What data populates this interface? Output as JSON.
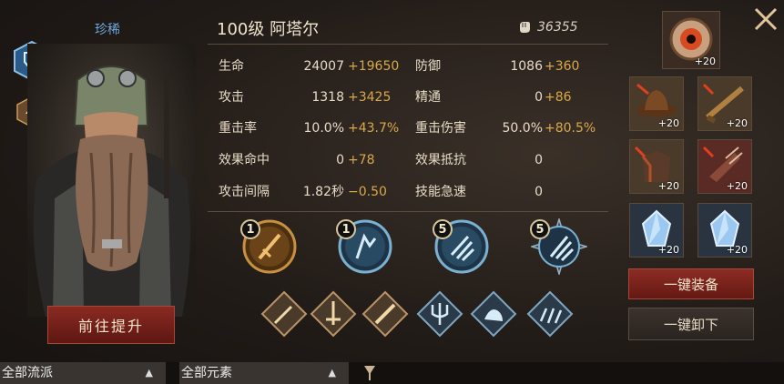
{
  "hero": {
    "rarity": "珍稀",
    "level_name": "100级  阿塔尔",
    "power": "36355",
    "goto_button": "前往提升"
  },
  "stats": [
    {
      "label": "生命",
      "value": "24007",
      "bonus": "+19650"
    },
    {
      "label": "防御",
      "value": "1086",
      "bonus": "+360"
    },
    {
      "label": "攻击",
      "value": "1318",
      "bonus": "+3425"
    },
    {
      "label": "精通",
      "value": "0",
      "bonus": "+86"
    },
    {
      "label": "重击率",
      "value": "10.0%",
      "bonus": "+43.7%"
    },
    {
      "label": "重击伤害",
      "value": "50.0%",
      "bonus": "+80.5%"
    },
    {
      "label": "效果命中",
      "value": "0",
      "bonus": "+78"
    },
    {
      "label": "效果抵抗",
      "value": "0",
      "bonus": ""
    },
    {
      "label": "攻击间隔",
      "value": "1.82秒",
      "bonus": "−0.50"
    },
    {
      "label": "技能急速",
      "value": "0",
      "bonus": ""
    }
  ],
  "skills": [
    {
      "level": "1",
      "icon": "sword-skill-icon"
    },
    {
      "level": "1",
      "icon": "strike-skill-icon"
    },
    {
      "level": "5",
      "icon": "claw-skill-icon"
    },
    {
      "level": "5",
      "icon": "trident-skill-icon"
    }
  ],
  "runes": [
    "dagger-rune-icon",
    "sword-rune-icon",
    "blade-rune-icon",
    "trident-rune-icon",
    "beast-rune-icon",
    "triple-rune-icon"
  ],
  "equipment": [
    {
      "name": "eye-orb-icon",
      "level": "+20"
    },
    {
      "name": "hat-icon",
      "level": "+20"
    },
    {
      "name": "gun-icon",
      "level": "+20"
    },
    {
      "name": "armor-icon",
      "level": "+20"
    },
    {
      "name": "gauntlet-icon",
      "level": "+20"
    },
    {
      "name": "crystal-icon",
      "level": "+20"
    },
    {
      "name": "crystal-icon",
      "level": "+20"
    }
  ],
  "buttons": {
    "equip_all": "一键装备",
    "unequip_all": "一键卸下"
  },
  "filters": {
    "school": "全部流派",
    "element": "全部元素"
  },
  "colors": {
    "bonus": "#d9a84a",
    "rarity": "#6fa8dc",
    "primary_button": "#8c2c24"
  }
}
